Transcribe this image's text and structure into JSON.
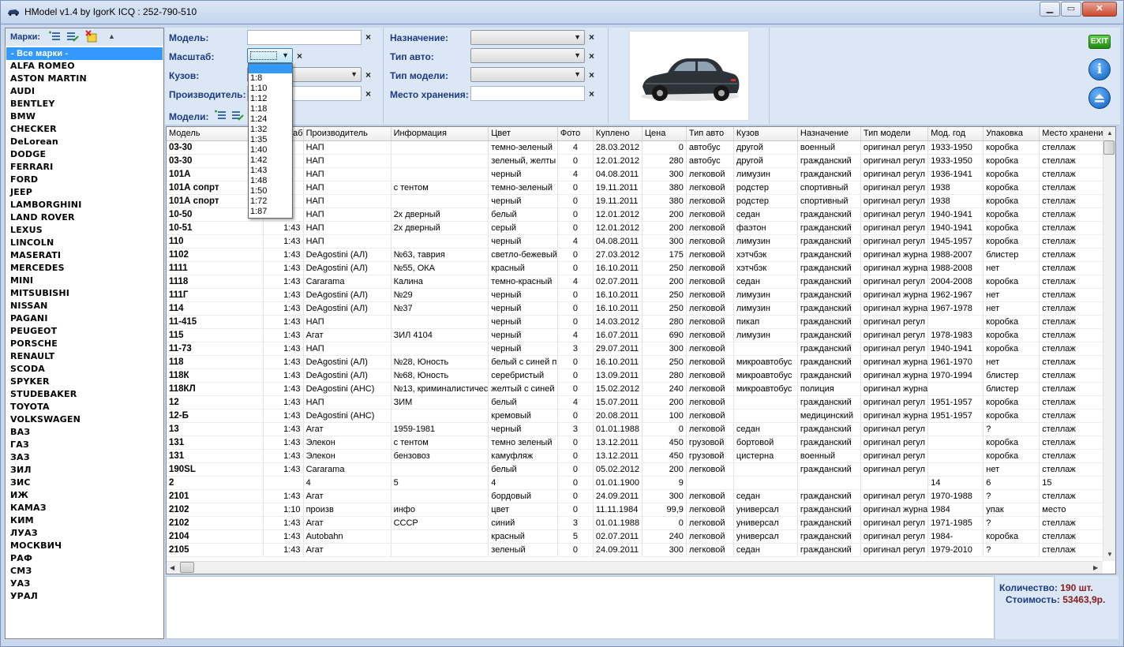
{
  "window": {
    "title": "HModel v1.4 by IgorK ICQ : 252-790-510"
  },
  "brands": {
    "label": "Марки:",
    "items": [
      "- Все марки -",
      "ALFA ROMEO",
      "ASTON MARTIN",
      "AUDI",
      "BENTLEY",
      "BMW",
      "CHECKER",
      "DeLorean",
      "DODGE",
      "FERRARI",
      "FORD",
      "JEEP",
      "LAMBORGHINI",
      "LAND ROVER",
      "LEXUS",
      "LINCOLN",
      "MASERATI",
      "MERCEDES",
      "MINI",
      "MITSUBISHI",
      "NISSAN",
      "PAGANI",
      "PEUGEOT",
      "PORSCHE",
      "RENAULT",
      "SCODA",
      "SPYKER",
      "STUDEBAKER",
      "TOYOTA",
      "VOLKSWAGEN",
      "ВАЗ",
      "ГАЗ",
      "ЗАЗ",
      "ЗИЛ",
      "ЗИС",
      "ИЖ",
      "КАМАЗ",
      "КИМ",
      "ЛУАЗ",
      "МОСКВИЧ",
      "РАФ",
      "СМЗ",
      "УАЗ",
      "УРАЛ"
    ]
  },
  "filters": {
    "model_label": "Модель:",
    "scale_label": "Масштаб:",
    "body_label": "Кузов:",
    "maker_label": "Производитель:",
    "models_label": "Модели:",
    "purpose_label": "Назначение:",
    "cartype_label": "Тип авто:",
    "modeltype_label": "Тип модели:",
    "storage_label": "Место хранения:",
    "clear_symbol": "×",
    "scale_options": [
      "1:8",
      "1:10",
      "1:12",
      "1:18",
      "1:24",
      "1:32",
      "1:35",
      "1:40",
      "1:42",
      "1:43",
      "1:48",
      "1:50",
      "1:72",
      "1:87"
    ]
  },
  "table": {
    "columns": [
      "Модель",
      "Масштаб",
      "Производитель",
      "Информация",
      "Цвет",
      "Фото",
      "Куплено",
      "Цена",
      "Тип авто",
      "Кузов",
      "Назначение",
      "Тип модели",
      "Мод. год",
      "Упаковка",
      "Место хранения"
    ],
    "rows": [
      [
        "03-30",
        "",
        "НАП",
        "",
        "темно-зеленый",
        "4",
        "28.03.2012",
        "0",
        "автобус",
        "другой",
        "военный",
        "оригинал регул",
        "1933-1950",
        "коробка",
        "стеллаж"
      ],
      [
        "03-30",
        "",
        "НАП",
        "",
        "зеленый, желты",
        "0",
        "12.01.2012",
        "280",
        "автобус",
        "другой",
        "гражданский",
        "оригинал регул",
        "1933-1950",
        "коробка",
        "стеллаж"
      ],
      [
        "101А",
        "",
        "НАП",
        "",
        "черный",
        "4",
        "04.08.2011",
        "300",
        "легковой",
        "лимузин",
        "гражданский",
        "оригинал регул",
        "1936-1941",
        "коробка",
        "стеллаж"
      ],
      [
        "101А сопрт",
        "",
        "НАП",
        "с тентом",
        "темно-зеленый",
        "0",
        "19.11.2011",
        "380",
        "легковой",
        "родстер",
        "спортивный",
        "оригинал регул",
        "1938",
        "коробка",
        "стеллаж"
      ],
      [
        "101А спорт",
        "",
        "НАП",
        "",
        "черный",
        "0",
        "19.11.2011",
        "380",
        "легковой",
        "родстер",
        "спортивный",
        "оригинал регул",
        "1938",
        "коробка",
        "стеллаж"
      ],
      [
        "10-50",
        "",
        "НАП",
        "2х дверный",
        "белый",
        "0",
        "12.01.2012",
        "200",
        "легковой",
        "седан",
        "гражданский",
        "оригинал регул",
        "1940-1941",
        "коробка",
        "стеллаж"
      ],
      [
        "10-51",
        "1:43",
        "НАП",
        "2х дверный",
        "серый",
        "0",
        "12.01.2012",
        "200",
        "легковой",
        "фаэтон",
        "гражданский",
        "оригинал регул",
        "1940-1941",
        "коробка",
        "стеллаж"
      ],
      [
        "110",
        "1:43",
        "НАП",
        "",
        "черный",
        "4",
        "04.08.2011",
        "300",
        "легковой",
        "лимузин",
        "гражданский",
        "оригинал регул",
        "1945-1957",
        "коробка",
        "стеллаж"
      ],
      [
        "1102",
        "1:43",
        "DeAgostini (АЛ)",
        "№63, таврия",
        "светло-бежевый",
        "0",
        "27.03.2012",
        "175",
        "легковой",
        "хэтчбэк",
        "гражданский",
        "оригинал журна",
        "1988-2007",
        "блистер",
        "стеллаж"
      ],
      [
        "1111",
        "1:43",
        "DeAgostini (АЛ)",
        "№55, ОКА",
        "красный",
        "0",
        "16.10.2011",
        "250",
        "легковой",
        "хэтчбэк",
        "гражданский",
        "оригинал журна",
        "1988-2008",
        "нет",
        "стеллаж"
      ],
      [
        "1118",
        "1:43",
        "Cararama",
        "Калина",
        "темно-красный",
        "4",
        "02.07.2011",
        "200",
        "легковой",
        "седан",
        "гражданский",
        "оригинал регул",
        "2004-2008",
        "коробка",
        "стеллаж"
      ],
      [
        "111Г",
        "1:43",
        "DeAgostini (АЛ)",
        "№29",
        "черный",
        "0",
        "16.10.2011",
        "250",
        "легковой",
        "лимузин",
        "гражданский",
        "оригинал журна",
        "1962-1967",
        "нет",
        "стеллаж"
      ],
      [
        "114",
        "1:43",
        "DeAgostini (АЛ)",
        "№37",
        "черный",
        "0",
        "16.10.2011",
        "250",
        "легковой",
        "лимузин",
        "гражданский",
        "оригинал журна",
        "1967-1978",
        "нет",
        "стеллаж"
      ],
      [
        "11-415",
        "1:43",
        "НАП",
        "",
        "черный",
        "0",
        "14.03.2012",
        "280",
        "легковой",
        "пикап",
        "гражданский",
        "оригинал регул",
        "",
        "коробка",
        "стеллаж"
      ],
      [
        "115",
        "1:43",
        "Агат",
        "ЗИЛ 4104",
        "черный",
        "4",
        "16.07.2011",
        "690",
        "легковой",
        "лимузин",
        "гражданский",
        "оригинал регул",
        "1978-1983",
        "коробка",
        "стеллаж"
      ],
      [
        "11-73",
        "1:43",
        "НАП",
        "",
        "черный",
        "3",
        "29.07.2011",
        "300",
        "легковой",
        "",
        "гражданский",
        "оригинал регул",
        "1940-1941",
        "коробка",
        "стеллаж"
      ],
      [
        "118",
        "1:43",
        "DeAgostini (АЛ)",
        "№28, Юность",
        "белый с синей п",
        "0",
        "16.10.2011",
        "250",
        "легковой",
        "микроавтобус",
        "гражданский",
        "оригинал журна",
        "1961-1970",
        "нет",
        "стеллаж"
      ],
      [
        "118К",
        "1:43",
        "DeAgostini (АЛ)",
        "№68, Юность",
        "серебристый",
        "0",
        "13.09.2011",
        "280",
        "легковой",
        "микроавтобус",
        "гражданский",
        "оригинал журна",
        "1970-1994",
        "блистер",
        "стеллаж"
      ],
      [
        "118КЛ",
        "1:43",
        "DeAgostini (АНС)",
        "№13, криминалистичес",
        "желтый с синей",
        "0",
        "15.02.2012",
        "240",
        "легковой",
        "микроавтобус",
        "полиция",
        "оригинал журна",
        "",
        "блистер",
        "стеллаж"
      ],
      [
        "12",
        "1:43",
        "НАП",
        "ЗИМ",
        "белый",
        "4",
        "15.07.2011",
        "200",
        "легковой",
        "",
        "гражданский",
        "оригинал регул",
        "1951-1957",
        "коробка",
        "стеллаж"
      ],
      [
        "12-Б",
        "1:43",
        "DeAgostini (АНС)",
        "",
        "кремовый",
        "0",
        "20.08.2011",
        "100",
        "легковой",
        "",
        "медицинский",
        "оригинал журна",
        "1951-1957",
        "коробка",
        "стеллаж"
      ],
      [
        "13",
        "1:43",
        "Агат",
        "1959-1981",
        "черный",
        "3",
        "01.01.1988",
        "0",
        "легковой",
        "седан",
        "гражданский",
        "оригинал регул",
        "",
        "?",
        "стеллаж"
      ],
      [
        "131",
        "1:43",
        "Элекон",
        "с тентом",
        "темно зеленый",
        "0",
        "13.12.2011",
        "450",
        "грузовой",
        "бортовой",
        "гражданский",
        "оригинал регул",
        "",
        "коробка",
        "стеллаж"
      ],
      [
        "131",
        "1:43",
        "Элекон",
        "бензовоз",
        "камуфляж",
        "0",
        "13.12.2011",
        "450",
        "грузовой",
        "цистерна",
        "военный",
        "оригинал регул",
        "",
        "коробка",
        "стеллаж"
      ],
      [
        "190SL",
        "1:43",
        "Cararama",
        "",
        "белый",
        "0",
        "05.02.2012",
        "200",
        "легковой",
        "",
        "гражданский",
        "оригинал регул",
        "",
        "нет",
        "стеллаж"
      ],
      [
        "2",
        "",
        "4",
        "5",
        "4",
        "0",
        "01.01.1900",
        "9",
        "",
        "",
        "",
        "",
        "14",
        "6",
        "15"
      ],
      [
        "2101",
        "1:43",
        "Агат",
        "",
        "бордовый",
        "0",
        "24.09.2011",
        "300",
        "легковой",
        "седан",
        "гражданский",
        "оригинал регул",
        "1970-1988",
        "?",
        "стеллаж"
      ],
      [
        "2102",
        "1:10",
        "произв",
        "инфо",
        "цвет",
        "0",
        "11.11.1984",
        "99,9",
        "легковой",
        "универсал",
        "гражданский",
        "оригинал журна",
        "1984",
        "упак",
        "место"
      ],
      [
        "2102",
        "1:43",
        "Агат",
        "СССР",
        "синий",
        "3",
        "01.01.1988",
        "0",
        "легковой",
        "универсал",
        "гражданский",
        "оригинал регул",
        "1971-1985",
        "?",
        "стеллаж"
      ],
      [
        "2104",
        "1:43",
        "Autobahn",
        "",
        "красный",
        "5",
        "02.07.2011",
        "240",
        "легковой",
        "универсал",
        "гражданский",
        "оригинал регул",
        "1984-",
        "коробка",
        "стеллаж"
      ],
      [
        "2105",
        "1:43",
        "Агат",
        "",
        "зеленый",
        "0",
        "24.09.2011",
        "300",
        "легковой",
        "седан",
        "гражданский",
        "оригинал регул",
        "1979-2010",
        "?",
        "стеллаж"
      ]
    ]
  },
  "stats": {
    "count_label": "Количество:",
    "count_value": "190 шт.",
    "cost_label": "Стоимость:",
    "cost_value": "53463,9р."
  },
  "buttons": {
    "exit": "EXIT",
    "info": "i"
  },
  "colors": {
    "accent": "#3399ff",
    "label": "#1c3a86",
    "stat_value": "#8b1a1a",
    "exit_green": "#2e9a1c"
  }
}
